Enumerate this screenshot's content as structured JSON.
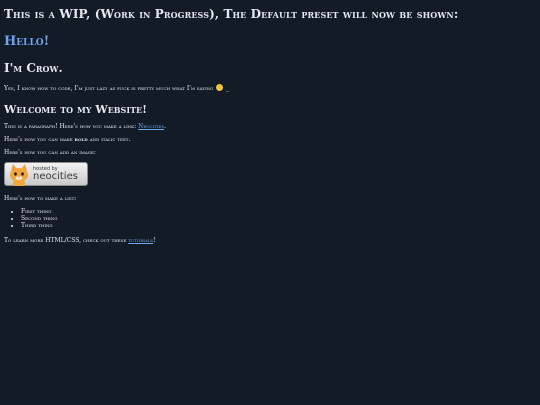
{
  "header": {
    "wip_notice": "This is a WIP, (Work in Progress), The Default preset will now be shown:",
    "hello": "Hello!",
    "name": "I'm Crow.",
    "intro_note": "Yes, I know how to code, I'm just lazy as fuck is pretty much what I'm saying",
    "intro_note_end": "_"
  },
  "main": {
    "welcome_heading": "Welcome to my Website!",
    "paragraph_text": "This is a paragraph! Here's how you make a link:",
    "paragraph_link": "Neocities",
    "paragraph_end": ".",
    "bold_prefix": "Here's how you can make",
    "bold_word": "bold",
    "bold_suffix": "and italic text.",
    "image_text": "Here's how you can add an image:",
    "badge": {
      "small_label": "hosted by",
      "big_label": "neocities"
    },
    "list_intro": "Here's how to make a list:",
    "list_items": [
      "First thing",
      "Second thing",
      "Third thing"
    ],
    "tutorial_text": "To learn more HTML/CSS, check out these",
    "tutorial_link": "tutorials",
    "tutorial_end": "!"
  },
  "colors": {
    "background": "#131b27",
    "text": "#e6e8ee",
    "link": "#6ea6f0",
    "emoji": "#f3c440"
  },
  "icons": {
    "emoji": "smiley-face-icon",
    "badge": "neocities-cat-icon"
  }
}
